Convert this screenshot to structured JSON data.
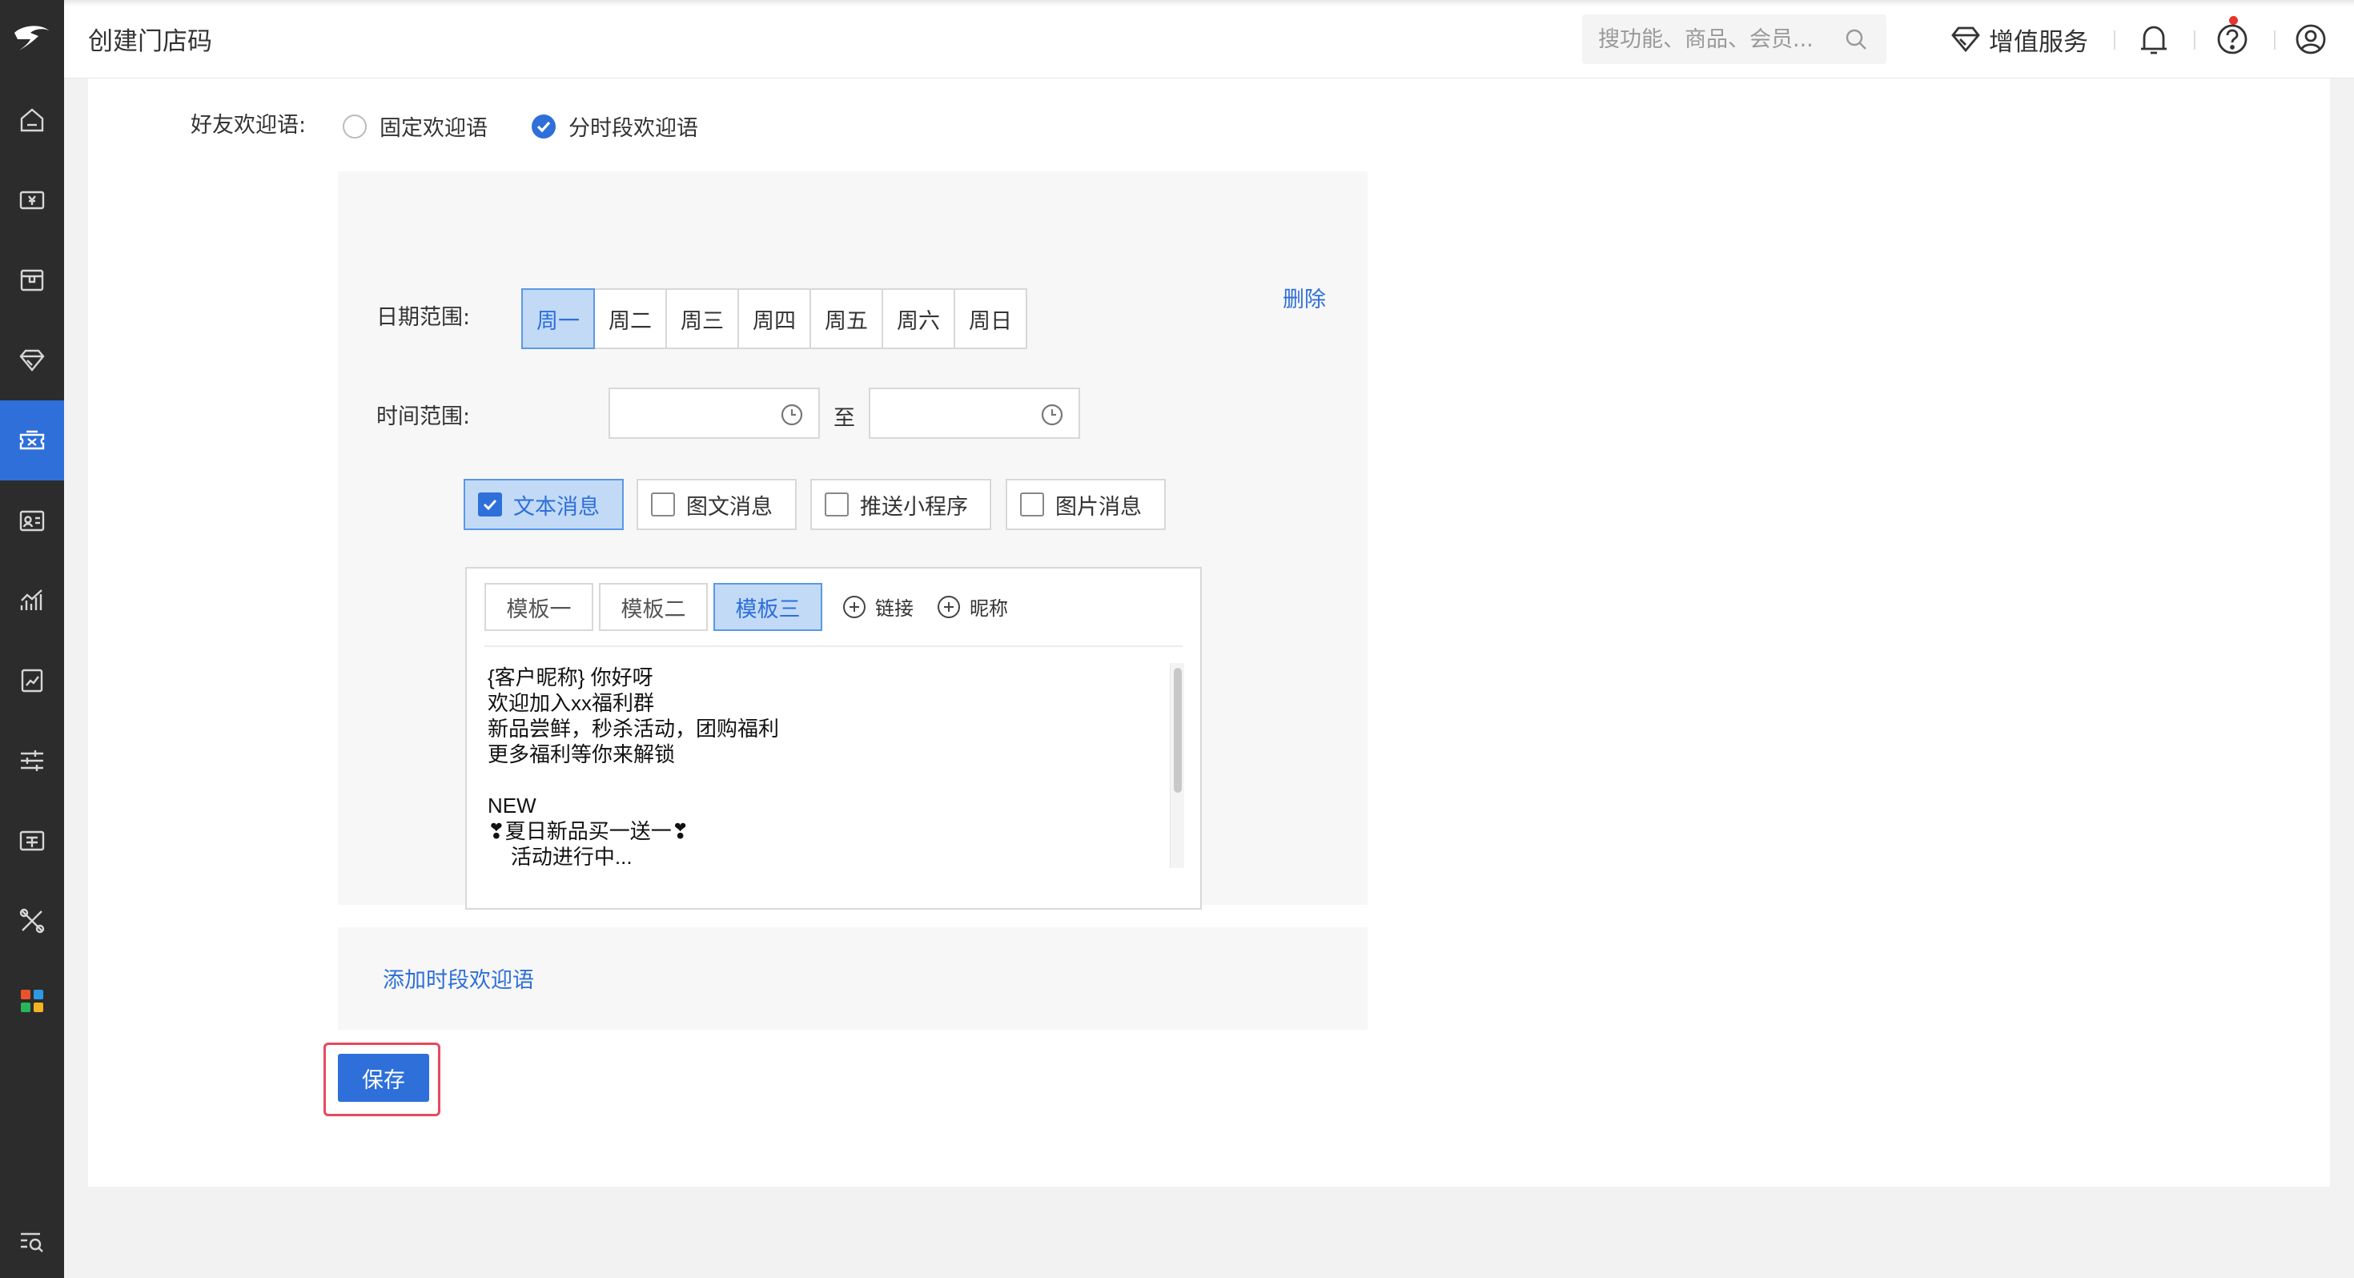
{
  "app": {
    "page_title": "创建门店码",
    "accent_color": "#2e6fd9"
  },
  "search": {
    "placeholder": "搜功能、商品、会员..."
  },
  "header": {
    "vas_label": "增值服务"
  },
  "sidebar": {
    "items": [
      {
        "icon": "home-icon",
        "active": false
      },
      {
        "icon": "money-icon",
        "active": false
      },
      {
        "icon": "box-icon",
        "active": false
      },
      {
        "icon": "diamond-icon",
        "active": false
      },
      {
        "icon": "coupon-icon",
        "active": true
      },
      {
        "icon": "id-card-icon",
        "active": false
      },
      {
        "icon": "chart-icon",
        "active": false
      },
      {
        "icon": "report-icon",
        "active": false
      },
      {
        "icon": "settings-sliders-icon",
        "active": false
      },
      {
        "icon": "ticket-icon",
        "active": false
      },
      {
        "icon": "tools-icon",
        "active": false
      },
      {
        "icon": "apps-icon",
        "active": false
      },
      {
        "icon": "search-list-icon",
        "active": false
      }
    ]
  },
  "form": {
    "welcome_label": "好友欢迎语:",
    "welcome_options": [
      {
        "label": "固定欢迎语",
        "checked": false
      },
      {
        "label": "分时段欢迎语",
        "checked": true
      }
    ],
    "date_range_label": "日期范围:",
    "delete_label": "删除",
    "days": [
      {
        "label": "周一",
        "active": true
      },
      {
        "label": "周二",
        "active": false
      },
      {
        "label": "周三",
        "active": false
      },
      {
        "label": "周四",
        "active": false
      },
      {
        "label": "周五",
        "active": false
      },
      {
        "label": "周六",
        "active": false
      },
      {
        "label": "周日",
        "active": false
      }
    ],
    "time_range_label": "时间范围:",
    "time_to": "至",
    "time_start": "",
    "time_end": "",
    "message_types": [
      {
        "label": "文本消息",
        "checked": true
      },
      {
        "label": "图文消息",
        "checked": false
      },
      {
        "label": "推送小程序",
        "checked": false
      },
      {
        "label": "图片消息",
        "checked": false
      }
    ],
    "templates": [
      {
        "label": "模板一",
        "active": false
      },
      {
        "label": "模板二",
        "active": false
      },
      {
        "label": "模板三",
        "active": true
      }
    ],
    "insert_link_label": "链接",
    "insert_nickname_label": "昵称",
    "message_lines": [
      "{客户昵称} 你好呀",
      "欢迎加入xx福利群",
      "新品尝鲜，秒杀活动，团购福利",
      "更多福利等你来解锁",
      "",
      "NEW",
      "❣夏日新品买一送一❣",
      "    活动进行中..."
    ],
    "add_period_label": "添加时段欢迎语",
    "save_label": "保存"
  }
}
